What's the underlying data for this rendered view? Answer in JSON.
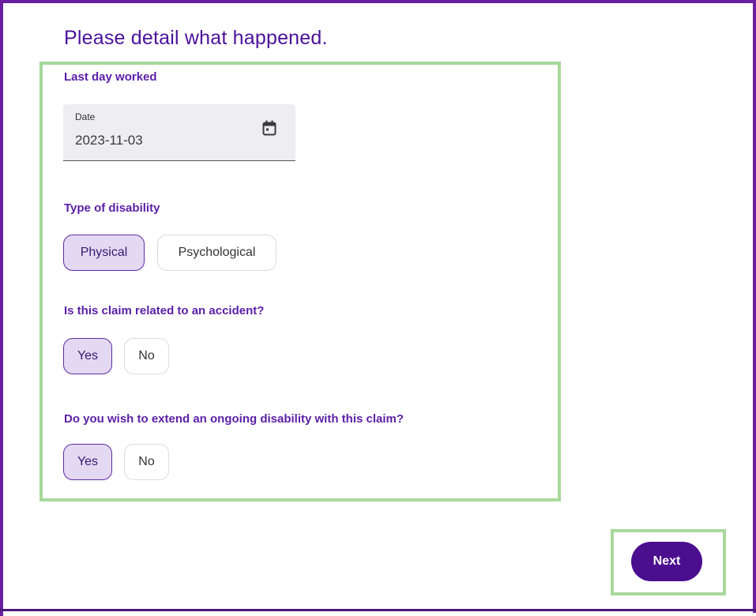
{
  "page": {
    "title": "Please detail what happened."
  },
  "last_day": {
    "label": "Last day worked",
    "field_caption": "Date",
    "value": "2023-11-03",
    "icon": "calendar-icon"
  },
  "disability_type": {
    "label": "Type of disability",
    "options": [
      "Physical",
      "Psychological"
    ],
    "selected": "Physical"
  },
  "accident": {
    "label": "Is this claim related to an accident?",
    "options": [
      "Yes",
      "No"
    ],
    "selected": "Yes"
  },
  "extend": {
    "label": "Do you wish to extend an ongoing disability with this claim?",
    "options": [
      "Yes",
      "No"
    ],
    "selected": "Yes"
  },
  "actions": {
    "next_label": "Next"
  },
  "colors": {
    "primary": "#4a0e8f",
    "label_purple": "#5b1fa6",
    "selected_chip_bg": "#e3d9f3",
    "highlight_green": "#a8d89b",
    "frame_purple": "#6a1fa0"
  }
}
